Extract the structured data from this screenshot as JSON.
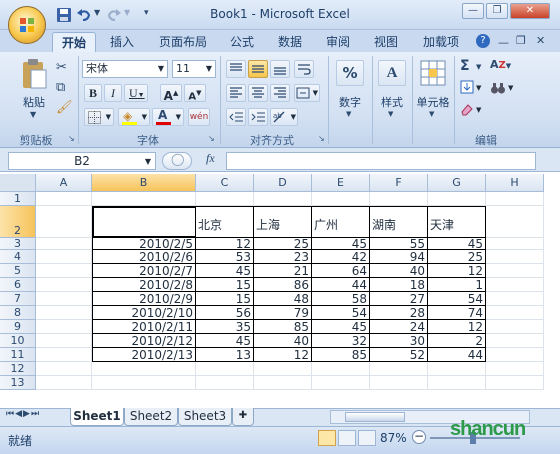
{
  "window": {
    "title": "Book1 - Microsoft Excel"
  },
  "tabs": [
    "开始",
    "插入",
    "页面布局",
    "公式",
    "数据",
    "审阅",
    "视图",
    "加载项"
  ],
  "font": {
    "name": "宋体",
    "size": "11"
  },
  "groups": {
    "clipboard": "剪贴板",
    "font": "字体",
    "alignment": "对齐方式",
    "editing": "编辑"
  },
  "buttons": {
    "paste": "粘贴",
    "number": "数字",
    "style": "样式",
    "cells": "单元格",
    "bold": "B",
    "italic": "I",
    "underline": "U",
    "grow": "A",
    "shrink": "A",
    "fontcolor": "A",
    "sum": "Σ",
    "sort": "A"
  },
  "namebox": "B2",
  "fx": "fx",
  "columns": [
    "A",
    "B",
    "C",
    "D",
    "E",
    "F",
    "G",
    "H"
  ],
  "rows": [
    "1",
    "2",
    "3",
    "4",
    "5",
    "6",
    "7",
    "8",
    "9",
    "10",
    "11",
    "12",
    "13"
  ],
  "headers": [
    "北京",
    "上海",
    "广州",
    "湖南",
    "天津"
  ],
  "table": [
    [
      "2010/2/5",
      "12",
      "25",
      "45",
      "55",
      "45"
    ],
    [
      "2010/2/6",
      "53",
      "23",
      "42",
      "94",
      "25"
    ],
    [
      "2010/2/7",
      "45",
      "21",
      "64",
      "40",
      "12"
    ],
    [
      "2010/2/8",
      "15",
      "86",
      "44",
      "18",
      "1"
    ],
    [
      "2010/2/9",
      "15",
      "48",
      "58",
      "27",
      "54"
    ],
    [
      "2010/2/10",
      "56",
      "79",
      "54",
      "28",
      "74"
    ],
    [
      "2010/2/11",
      "35",
      "85",
      "45",
      "24",
      "12"
    ],
    [
      "2010/2/12",
      "45",
      "40",
      "32",
      "30",
      "2"
    ],
    [
      "2010/2/13",
      "13",
      "12",
      "85",
      "52",
      "44"
    ]
  ],
  "sheets": [
    "Sheet1",
    "Sheet2",
    "Sheet3"
  ],
  "status": {
    "ready": "就绪",
    "zoom": "87%"
  },
  "watermark": "shancun"
}
